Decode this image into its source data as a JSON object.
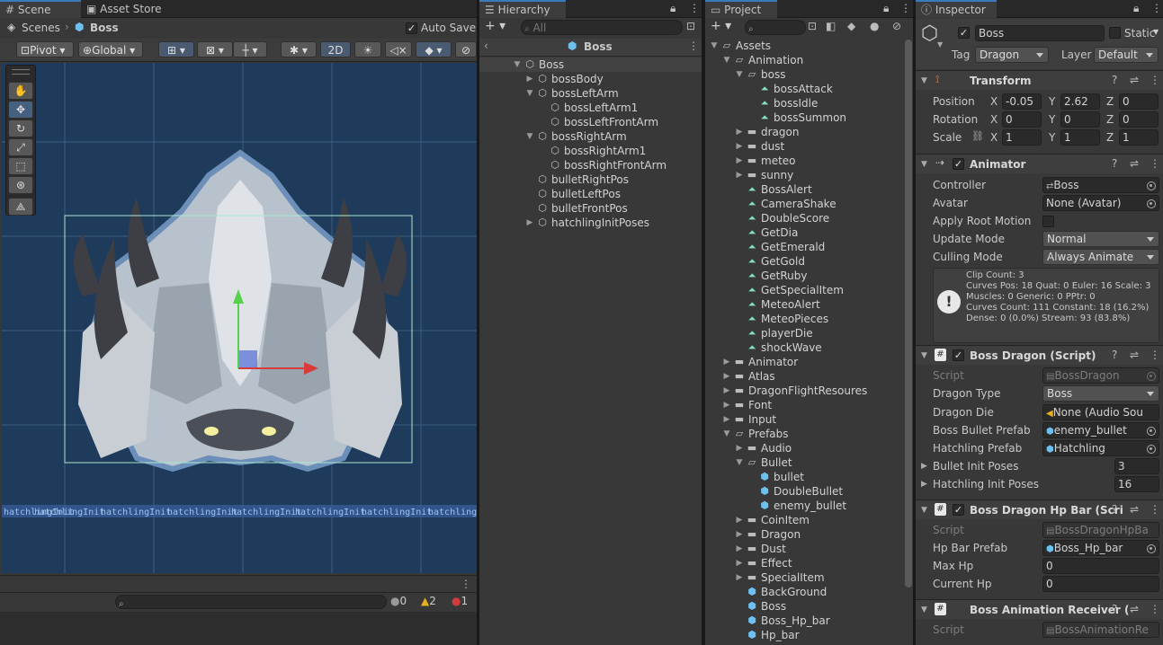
{
  "scene": {
    "tabs": [
      "Scene",
      "Asset Store"
    ],
    "breadcrumb_root": "Scenes",
    "breadcrumb_current": "Boss",
    "auto_save": "Auto Save",
    "pivot": "Pivot",
    "global": "Global",
    "mode_2d": "2D",
    "overlay_label": "hatchlingInit",
    "console": {
      "info": "0",
      "warn": "2",
      "error": "1"
    }
  },
  "hierarchy": {
    "tab": "Hierarchy",
    "search_placeholder": "All",
    "title": "Boss",
    "items": [
      {
        "label": "Boss",
        "depth": 0,
        "arrow": "open"
      },
      {
        "label": "bossBody",
        "depth": 1,
        "arrow": "closed"
      },
      {
        "label": "bossLeftArm",
        "depth": 1,
        "arrow": "open"
      },
      {
        "label": "bossLeftArm1",
        "depth": 2,
        "arrow": ""
      },
      {
        "label": "bossLeftFrontArm",
        "depth": 2,
        "arrow": ""
      },
      {
        "label": "bossRightArm",
        "depth": 1,
        "arrow": "open"
      },
      {
        "label": "bossRightArm1",
        "depth": 2,
        "arrow": ""
      },
      {
        "label": "bossRightFrontArm",
        "depth": 2,
        "arrow": ""
      },
      {
        "label": "bulletRightPos",
        "depth": 1,
        "arrow": ""
      },
      {
        "label": "bulletLeftPos",
        "depth": 1,
        "arrow": ""
      },
      {
        "label": "bulletFrontPos",
        "depth": 1,
        "arrow": ""
      },
      {
        "label": "hatchlingInitPoses",
        "depth": 1,
        "arrow": "closed"
      }
    ]
  },
  "project": {
    "tab": "Project",
    "items": [
      {
        "label": "Assets",
        "depth": 0,
        "arrow": "open",
        "type": "folder"
      },
      {
        "label": "Animation",
        "depth": 1,
        "arrow": "open",
        "type": "folder"
      },
      {
        "label": "boss",
        "depth": 2,
        "arrow": "open",
        "type": "folder"
      },
      {
        "label": "bossAttack",
        "depth": 3,
        "arrow": "",
        "type": "anim"
      },
      {
        "label": "bossIdle",
        "depth": 3,
        "arrow": "",
        "type": "anim"
      },
      {
        "label": "bossSummon",
        "depth": 3,
        "arrow": "",
        "type": "anim"
      },
      {
        "label": "dragon",
        "depth": 2,
        "arrow": "closed",
        "type": "folder"
      },
      {
        "label": "dust",
        "depth": 2,
        "arrow": "closed",
        "type": "folder"
      },
      {
        "label": "meteo",
        "depth": 2,
        "arrow": "closed",
        "type": "folder"
      },
      {
        "label": "sunny",
        "depth": 2,
        "arrow": "closed",
        "type": "folder"
      },
      {
        "label": "BossAlert",
        "depth": 2,
        "arrow": "",
        "type": "anim"
      },
      {
        "label": "CameraShake",
        "depth": 2,
        "arrow": "",
        "type": "anim"
      },
      {
        "label": "DoubleScore",
        "depth": 2,
        "arrow": "",
        "type": "anim"
      },
      {
        "label": "GetDia",
        "depth": 2,
        "arrow": "",
        "type": "anim"
      },
      {
        "label": "GetEmerald",
        "depth": 2,
        "arrow": "",
        "type": "anim"
      },
      {
        "label": "GetGold",
        "depth": 2,
        "arrow": "",
        "type": "anim"
      },
      {
        "label": "GetRuby",
        "depth": 2,
        "arrow": "",
        "type": "anim"
      },
      {
        "label": "GetSpecialItem",
        "depth": 2,
        "arrow": "",
        "type": "anim"
      },
      {
        "label": "MeteoAlert",
        "depth": 2,
        "arrow": "",
        "type": "anim"
      },
      {
        "label": "MeteoPieces",
        "depth": 2,
        "arrow": "",
        "type": "anim"
      },
      {
        "label": "playerDie",
        "depth": 2,
        "arrow": "",
        "type": "anim"
      },
      {
        "label": "shockWave",
        "depth": 2,
        "arrow": "",
        "type": "anim"
      },
      {
        "label": "Animator",
        "depth": 1,
        "arrow": "closed",
        "type": "folder"
      },
      {
        "label": "Atlas",
        "depth": 1,
        "arrow": "closed",
        "type": "folder"
      },
      {
        "label": "DragonFlightResoures",
        "depth": 1,
        "arrow": "closed",
        "type": "folder"
      },
      {
        "label": "Font",
        "depth": 1,
        "arrow": "closed",
        "type": "folder"
      },
      {
        "label": "Input",
        "depth": 1,
        "arrow": "closed",
        "type": "folder"
      },
      {
        "label": "Prefabs",
        "depth": 1,
        "arrow": "open",
        "type": "folder"
      },
      {
        "label": "Audio",
        "depth": 2,
        "arrow": "closed",
        "type": "folder"
      },
      {
        "label": "Bullet",
        "depth": 2,
        "arrow": "open",
        "type": "folder"
      },
      {
        "label": "bullet",
        "depth": 3,
        "arrow": "",
        "type": "prefab"
      },
      {
        "label": "DoubleBullet",
        "depth": 3,
        "arrow": "",
        "type": "prefab"
      },
      {
        "label": "enemy_bullet",
        "depth": 3,
        "arrow": "",
        "type": "prefab"
      },
      {
        "label": "CoinItem",
        "depth": 2,
        "arrow": "closed",
        "type": "folder"
      },
      {
        "label": "Dragon",
        "depth": 2,
        "arrow": "closed",
        "type": "folder"
      },
      {
        "label": "Dust",
        "depth": 2,
        "arrow": "closed",
        "type": "folder"
      },
      {
        "label": "Effect",
        "depth": 2,
        "arrow": "closed",
        "type": "folder"
      },
      {
        "label": "SpecialItem",
        "depth": 2,
        "arrow": "closed",
        "type": "folder"
      },
      {
        "label": "BackGround",
        "depth": 2,
        "arrow": "",
        "type": "prefab"
      },
      {
        "label": "Boss",
        "depth": 2,
        "arrow": "",
        "type": "prefab"
      },
      {
        "label": "Boss_Hp_bar",
        "depth": 2,
        "arrow": "",
        "type": "prefab"
      },
      {
        "label": "Hp_bar",
        "depth": 2,
        "arrow": "",
        "type": "prefab"
      }
    ]
  },
  "inspector": {
    "tab": "Inspector",
    "object_name": "Boss",
    "static_label": "Static",
    "tag_label": "Tag",
    "tag_value": "Dragon",
    "layer_label": "Layer",
    "layer_value": "Default",
    "transform": {
      "title": "Transform",
      "position_label": "Position",
      "rotation_label": "Rotation",
      "scale_label": "Scale",
      "position": {
        "x": "-0.05",
        "y": "2.62",
        "z": "0"
      },
      "rotation": {
        "x": "0",
        "y": "0",
        "z": "0"
      },
      "scale": {
        "x": "1",
        "y": "1",
        "z": "1"
      }
    },
    "animator": {
      "title": "Animator",
      "controller_label": "Controller",
      "controller_value": "Boss",
      "avatar_label": "Avatar",
      "avatar_value": "None (Avatar)",
      "root_motion_label": "Apply Root Motion",
      "update_mode_label": "Update Mode",
      "update_mode_value": "Normal",
      "culling_mode_label": "Culling Mode",
      "culling_mode_value": "Always Animate",
      "info": [
        "Clip Count: 3",
        "Curves Pos: 18 Quat: 0 Euler: 16 Scale: 3",
        "Muscles: 0 Generic: 0 PPtr: 0",
        "Curves Count: 111 Constant: 18 (16.2%)",
        "Dense: 0 (0.0%) Stream: 93 (83.8%)"
      ]
    },
    "boss_dragon": {
      "title": "Boss Dragon (Script)",
      "script_label": "Script",
      "script_value": "BossDragon",
      "type_label": "Dragon Type",
      "type_value": "Boss",
      "die_label": "Dragon Die",
      "die_value": "None (Audio Sou",
      "bullet_label": "Boss Bullet Prefab",
      "bullet_value": "enemy_bullet",
      "hatchling_label": "Hatchling Prefab",
      "hatchling_value": "Hatchling",
      "bullet_init_label": "Bullet Init Poses",
      "bullet_init_value": "3",
      "hatchling_init_label": "Hatchling Init Poses",
      "hatchling_init_value": "16"
    },
    "hp_bar": {
      "title": "Boss Dragon Hp Bar (Scri",
      "script_label": "Script",
      "script_value": "BossDragonHpBa",
      "prefab_label": "Hp Bar Prefab",
      "prefab_value": "Boss_Hp_bar",
      "max_label": "Max Hp",
      "max_value": "0",
      "current_label": "Current Hp",
      "current_value": "0"
    },
    "anim_receiver": {
      "title": "Boss Animation Receiver (",
      "script_label": "Script",
      "script_value": "BossAnimationRe"
    }
  },
  "colors": {
    "accent": "#3a79bb",
    "scene_bg": "#1f3b5c",
    "grid": "#5478a0",
    "selection_rect": "#a8e6cf",
    "warn": "#e6b020",
    "error": "#d33a3a"
  }
}
